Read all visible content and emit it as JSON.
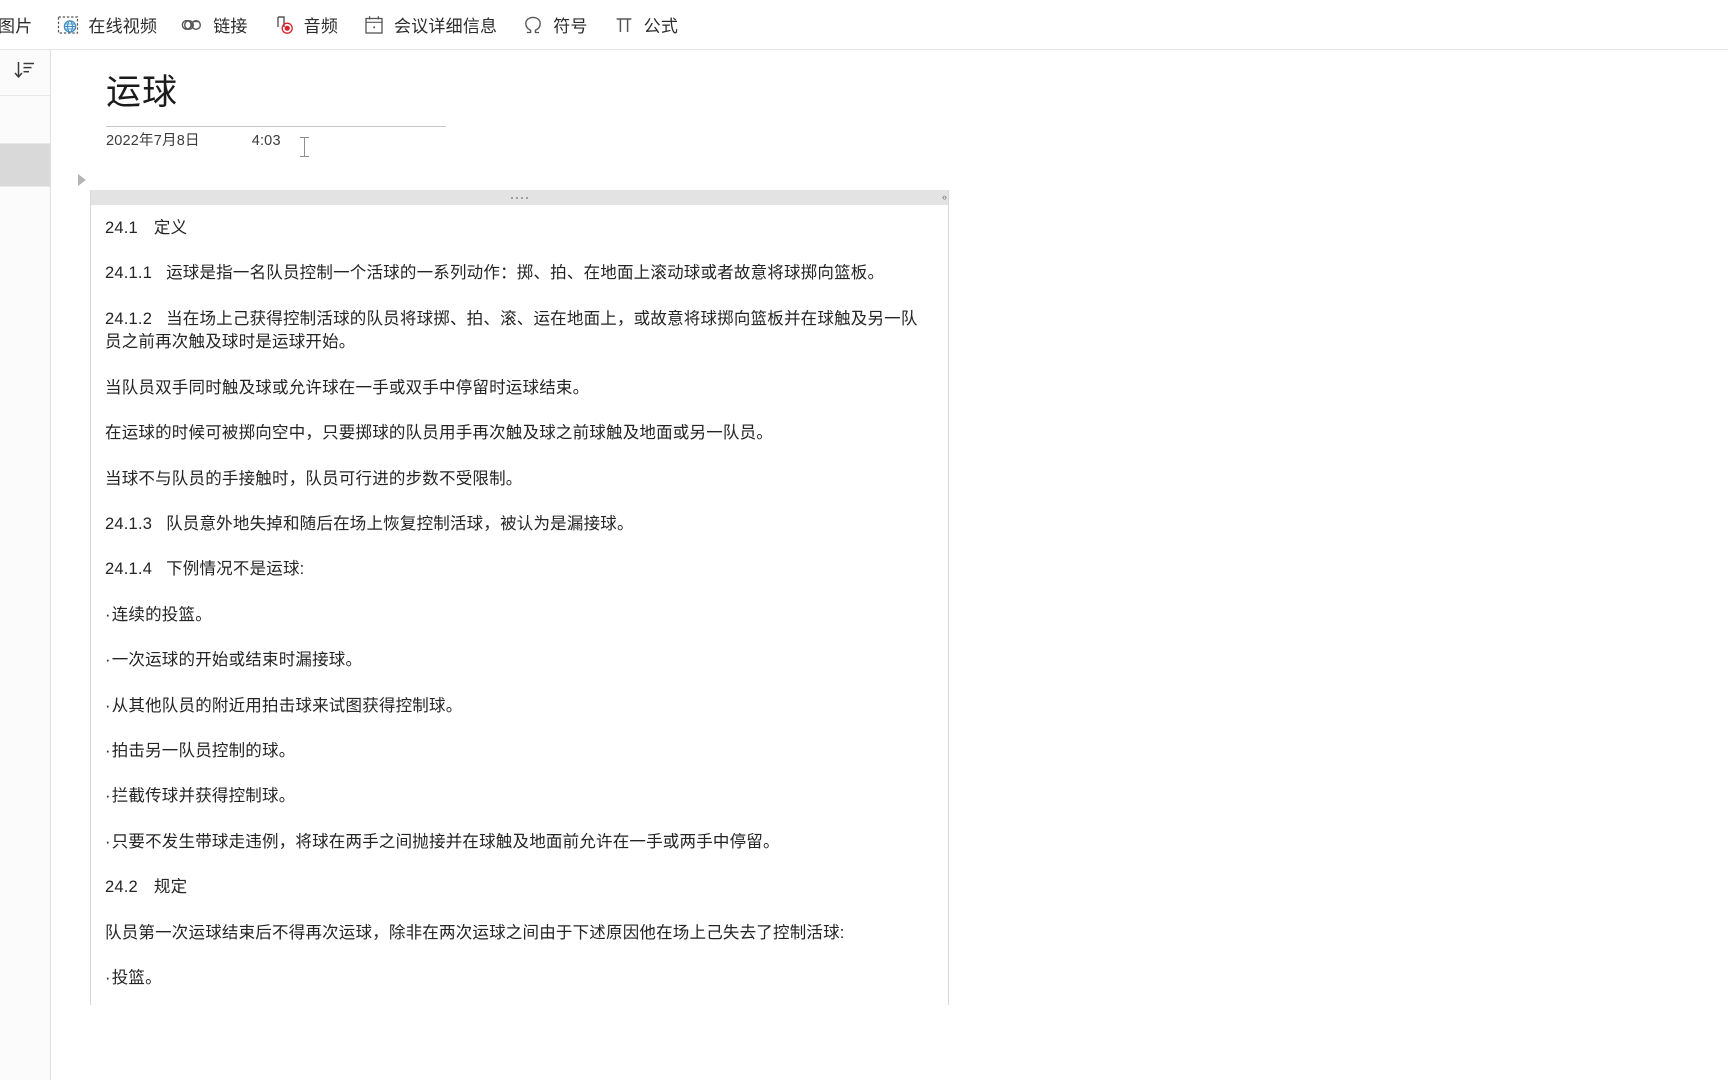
{
  "ribbon": {
    "items": [
      {
        "label": "图片",
        "icon": "picture-icon"
      },
      {
        "label": "在线视频",
        "icon": "online-video-icon"
      },
      {
        "label": "链接",
        "icon": "link-icon"
      },
      {
        "label": "音频",
        "icon": "audio-icon"
      },
      {
        "label": "会议详细信息",
        "icon": "calendar-icon"
      },
      {
        "label": "符号",
        "icon": "omega-symbol-icon"
      },
      {
        "label": "公式",
        "icon": "pi-equation-icon"
      }
    ]
  },
  "sidebar": {
    "sort_icon": "sort-outline-icon"
  },
  "document": {
    "title": "运球",
    "date": "2022年7月8日",
    "time": "4:03",
    "block": {
      "handle_dots": "....",
      "resize_grip": "‹›"
    },
    "paragraphs": [
      {
        "kind": "heading",
        "num": "24.1",
        "text": "定义"
      },
      {
        "kind": "numbered",
        "num": "24.1.1",
        "text": "运球是指一名队员控制一个活球的一系列动作：掷、拍、在地面上滚动球或者故意将球掷向篮板。"
      },
      {
        "kind": "numbered",
        "num": "24.1.2",
        "text": "当在场上己获得控制活球的队员将球掷、拍、滚、运在地面上，或故意将球掷向篮板并在球触及另一队员之前再次触及球时是运球开始。"
      },
      {
        "kind": "plain",
        "num": "",
        "text": "当队员双手同时触及球或允许球在一手或双手中停留时运球结束。"
      },
      {
        "kind": "plain",
        "num": "",
        "text": "在运球的时候可被掷向空中，只要掷球的队员用手再次触及球之前球触及地面或另一队员。"
      },
      {
        "kind": "plain",
        "num": "",
        "text": "当球不与队员的手接触时，队员可行进的步数不受限制。"
      },
      {
        "kind": "numbered",
        "num": "24.1.3",
        "text": "队员意外地失掉和随后在场上恢复控制活球，被认为是漏接球。"
      },
      {
        "kind": "numbered",
        "num": "24.1.4",
        "text": "下例情况不是运球:"
      },
      {
        "kind": "bullet",
        "num": "·",
        "text": "连续的投篮。"
      },
      {
        "kind": "bullet",
        "num": "·",
        "text": "一次运球的开始或结束时漏接球。"
      },
      {
        "kind": "bullet",
        "num": "·",
        "text": "从其他队员的附近用拍击球来试图获得控制球。"
      },
      {
        "kind": "bullet",
        "num": "·",
        "text": "拍击另一队员控制的球。"
      },
      {
        "kind": "bullet",
        "num": "·",
        "text": "拦截传球并获得控制球。"
      },
      {
        "kind": "bullet",
        "num": "·",
        "text": "只要不发生带球走违例，将球在两手之间抛接并在球触及地面前允许在一手或两手中停留。"
      },
      {
        "kind": "heading",
        "num": "24.2",
        "text": "规定"
      },
      {
        "kind": "plain",
        "num": "",
        "text": "队员第一次运球结束后不得再次运球，除非在两次运球之间由于下述原因他在场上己失去了控制活球:"
      },
      {
        "kind": "bullet",
        "num": "·",
        "text": "投篮。"
      }
    ]
  },
  "colors": {
    "accent_blue": "#3c8dc5",
    "record_red": "#d8232a",
    "block_handle": "#e3e3e3",
    "rail_selected": "#d9d9d9",
    "text": "#242424"
  }
}
